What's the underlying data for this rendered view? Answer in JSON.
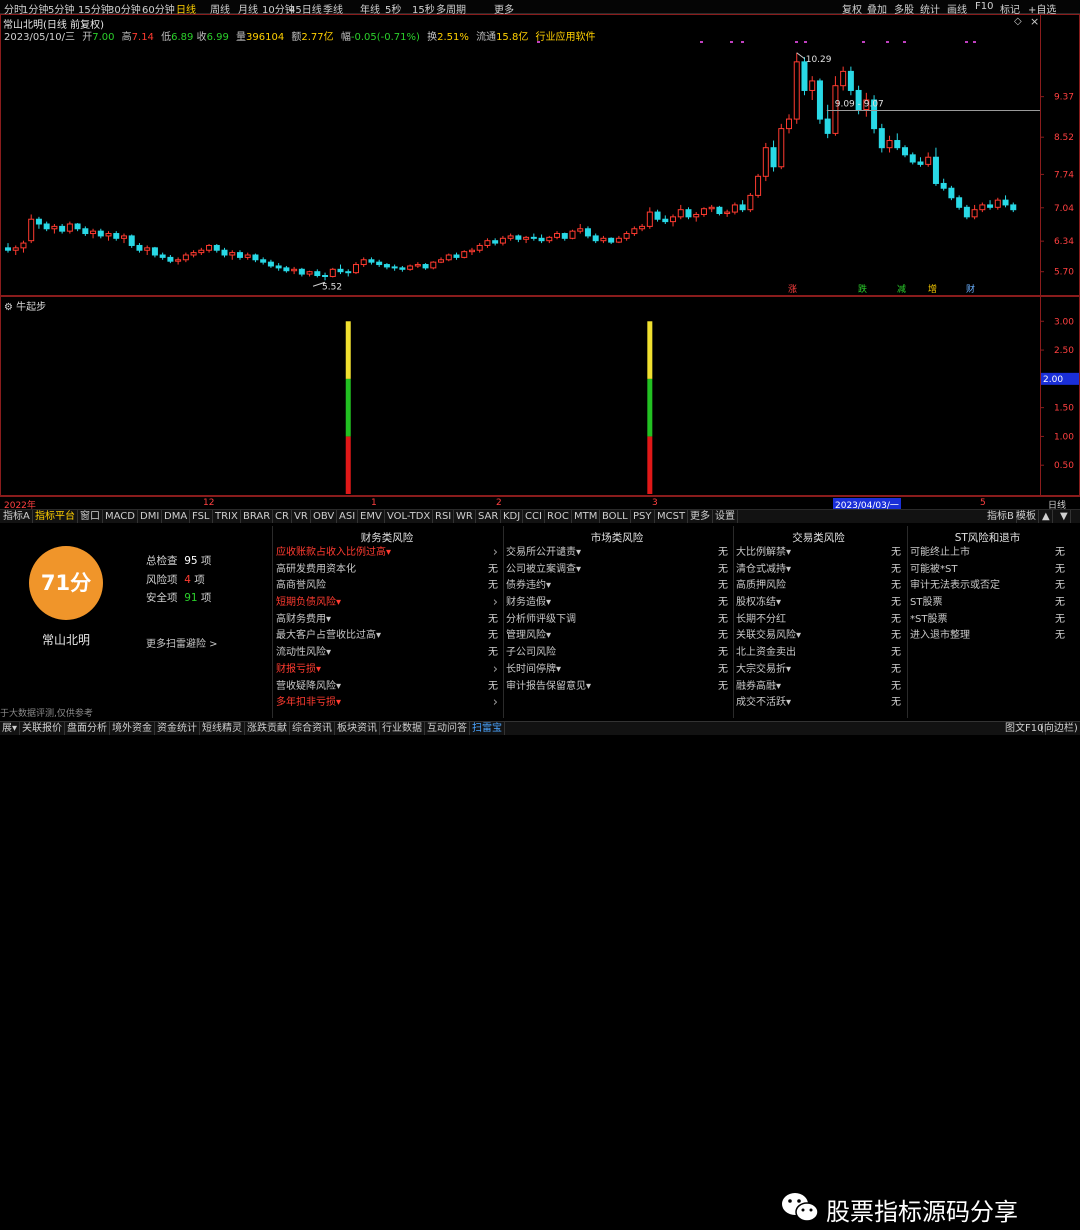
{
  "periods": [
    "分时",
    "1分钟",
    "5分钟",
    "15分钟",
    "30分钟",
    "60分钟",
    "日线",
    "周线",
    "月线",
    "10分钟",
    "45日线",
    "季线",
    "年线",
    "5秒",
    "15秒",
    "多周期",
    "更多"
  ],
  "active_period": "日线",
  "toolbar_right": [
    "复权",
    "叠加",
    "多股",
    "统计",
    "画线",
    "F10",
    "标记",
    "+自选"
  ],
  "stock": {
    "title": "常山北明(日线 前复权)",
    "date": "2023/05/10/三",
    "open_label": "开",
    "open": "7.00",
    "high_label": "高",
    "high": "7.14",
    "low_label": "低",
    "low": "6.89",
    "close_label": "收",
    "close": "6.99",
    "volume_label": "量",
    "volume": "396104",
    "amount_label": "额",
    "amount": "2.77亿",
    "change_label": "幅",
    "change": "-0.05(-0.71%)",
    "turnover_label": "换",
    "turnover": "2.51%",
    "float_label": "流通",
    "float": "15.8亿",
    "industry": "行业应用软件"
  },
  "price_axis": [
    "9.37",
    "8.52",
    "7.74",
    "7.04",
    "6.34",
    "5.70"
  ],
  "annotations": {
    "high": "10.29",
    "low": "5.52",
    "range": "9.09 - 9.07"
  },
  "event_markers": [
    "涨",
    "跌",
    "减",
    "增",
    "财"
  ],
  "sub_indicator": {
    "name": "牛起步",
    "axis": [
      "3.00",
      "2.50",
      "2.00",
      "1.50",
      "1.00",
      "0.50"
    ],
    "current": "2.00"
  },
  "date_axis": {
    "labels": [
      "2022年",
      "12",
      "1",
      "2",
      "3",
      "2023/04/03/一",
      "5"
    ],
    "right_label": "日线"
  },
  "indicator_tabs": [
    "指标A",
    "指标平台",
    "窗口",
    "MACD",
    "DMI",
    "DMA",
    "FSL",
    "TRIX",
    "BRAR",
    "CR",
    "VR",
    "OBV",
    "ASI",
    "EMV",
    "VOL-TDX",
    "RSI",
    "WR",
    "SAR",
    "KDJ",
    "CCI",
    "ROC",
    "MTM",
    "BOLL",
    "PSY",
    "MCST",
    "更多",
    "设置"
  ],
  "active_indicator_tab": "指标平台",
  "indicator_tabs_right": [
    "指标B",
    "模板",
    "▲",
    "▼"
  ],
  "risk": {
    "score": "71分",
    "company": "常山北明",
    "total_label": "总检查",
    "total": "95",
    "total_unit": "项",
    "risk_label": "风险项",
    "risk_count": "4",
    "risk_unit": "项",
    "safe_label": "安全项",
    "safe": "91",
    "safe_unit": "项",
    "more": "更多扫雷避险 >",
    "disclaimer": "于大数据评测,仅供参考",
    "columns": [
      {
        "title": "财务类风险",
        "items": [
          {
            "label": "应收账款占收入比例过高▾",
            "value": "›",
            "risk": true
          },
          {
            "label": "高研发费用资本化",
            "value": "无",
            "risk": false
          },
          {
            "label": "高商誉风险",
            "value": "无",
            "risk": false
          },
          {
            "label": "短期负债风险▾",
            "value": "›",
            "risk": true
          },
          {
            "label": "高财务费用▾",
            "value": "无",
            "risk": false
          },
          {
            "label": "最大客户占营收比过高▾",
            "value": "无",
            "risk": false
          },
          {
            "label": "流动性风险▾",
            "value": "无",
            "risk": false
          },
          {
            "label": "财报亏损▾",
            "value": "›",
            "risk": true
          },
          {
            "label": "营收疑降风险▾",
            "value": "无",
            "risk": false
          },
          {
            "label": "多年扣非亏损▾",
            "value": "›",
            "risk": true
          }
        ]
      },
      {
        "title": "市场类风险",
        "items": [
          {
            "label": "交易所公开谴责▾",
            "value": "无",
            "risk": false
          },
          {
            "label": "公司被立案调查▾",
            "value": "无",
            "risk": false
          },
          {
            "label": "债券违约▾",
            "value": "无",
            "risk": false
          },
          {
            "label": "财务造假▾",
            "value": "无",
            "risk": false
          },
          {
            "label": "分析师评级下调",
            "value": "无",
            "risk": false
          },
          {
            "label": "管理风险▾",
            "value": "无",
            "risk": false
          },
          {
            "label": "子公司风险",
            "value": "无",
            "risk": false
          },
          {
            "label": "长时间停牌▾",
            "value": "无",
            "risk": false
          },
          {
            "label": "审计报告保留意见▾",
            "value": "无",
            "risk": false
          }
        ]
      },
      {
        "title": "交易类风险",
        "items": [
          {
            "label": "大比例解禁▾",
            "value": "无",
            "risk": false
          },
          {
            "label": "清仓式减持▾",
            "value": "无",
            "risk": false
          },
          {
            "label": "高质押风险",
            "value": "无",
            "risk": false
          },
          {
            "label": "股权冻结▾",
            "value": "无",
            "risk": false
          },
          {
            "label": "长期不分红",
            "value": "无",
            "risk": false
          },
          {
            "label": "关联交易风险▾",
            "value": "无",
            "risk": false
          },
          {
            "label": "北上资金卖出",
            "value": "无",
            "risk": false
          },
          {
            "label": "大宗交易折▾",
            "value": "无",
            "risk": false
          },
          {
            "label": "融券高融▾",
            "value": "无",
            "risk": false
          },
          {
            "label": "成交不活跃▾",
            "value": "无",
            "risk": false
          }
        ]
      },
      {
        "title": "ST风险和退市",
        "items": [
          {
            "label": "可能终止上市",
            "value": "无",
            "risk": false
          },
          {
            "label": "可能被*ST",
            "value": "无",
            "risk": false
          },
          {
            "label": "审计无法表示或否定",
            "value": "无",
            "risk": false
          },
          {
            "label": "ST股票",
            "value": "无",
            "risk": false
          },
          {
            "label": "*ST股票",
            "value": "无",
            "risk": false
          },
          {
            "label": "进入退市整理",
            "value": "无",
            "risk": false
          }
        ]
      }
    ]
  },
  "statusbar": [
    "展▾",
    "关联报价",
    "盘面分析",
    "境外资金",
    "资金统计",
    "短线精灵",
    "涨跌贡献",
    "综合资讯",
    "板块资讯",
    "行业数据",
    "互动问答",
    "扫雷宝"
  ],
  "active_status": "扫雷宝",
  "statusbar_right": "图文F10",
  "statusbar_right2": "(向边栏)",
  "watermark": "股票指标源码分享",
  "colors": {
    "up": "#ff3b30",
    "down": "#29d9e6",
    "accent": "#ffd000",
    "score_bg": "#f0952a"
  },
  "chart_data": {
    "type": "candlestick",
    "ylim": [
      5.4,
      10.6
    ],
    "candles": [
      [
        6.2,
        6.3,
        6.1,
        6.15
      ],
      [
        6.15,
        6.25,
        6.05,
        6.2
      ],
      [
        6.2,
        6.35,
        6.1,
        6.3
      ],
      [
        6.35,
        6.9,
        6.3,
        6.8
      ],
      [
        6.8,
        6.85,
        6.6,
        6.7
      ],
      [
        6.7,
        6.75,
        6.55,
        6.6
      ],
      [
        6.6,
        6.7,
        6.5,
        6.65
      ],
      [
        6.65,
        6.7,
        6.5,
        6.55
      ],
      [
        6.55,
        6.75,
        6.5,
        6.7
      ],
      [
        6.7,
        6.72,
        6.55,
        6.6
      ],
      [
        6.6,
        6.65,
        6.45,
        6.5
      ],
      [
        6.5,
        6.6,
        6.4,
        6.55
      ],
      [
        6.55,
        6.6,
        6.4,
        6.45
      ],
      [
        6.45,
        6.55,
        6.35,
        6.5
      ],
      [
        6.5,
        6.55,
        6.35,
        6.4
      ],
      [
        6.4,
        6.5,
        6.3,
        6.45
      ],
      [
        6.45,
        6.48,
        6.2,
        6.25
      ],
      [
        6.25,
        6.3,
        6.1,
        6.15
      ],
      [
        6.15,
        6.25,
        6.05,
        6.2
      ],
      [
        6.2,
        6.22,
        6.0,
        6.05
      ],
      [
        6.05,
        6.1,
        5.95,
        6.0
      ],
      [
        6.0,
        6.05,
        5.88,
        5.92
      ],
      [
        5.92,
        6.0,
        5.85,
        5.95
      ],
      [
        5.95,
        6.1,
        5.9,
        6.05
      ],
      [
        6.05,
        6.15,
        6.0,
        6.1
      ],
      [
        6.1,
        6.2,
        6.05,
        6.15
      ],
      [
        6.15,
        6.28,
        6.1,
        6.25
      ],
      [
        6.25,
        6.28,
        6.1,
        6.15
      ],
      [
        6.15,
        6.2,
        6.0,
        6.05
      ],
      [
        6.05,
        6.15,
        5.95,
        6.1
      ],
      [
        6.1,
        6.15,
        5.95,
        6.0
      ],
      [
        6.0,
        6.1,
        5.95,
        6.05
      ],
      [
        6.05,
        6.08,
        5.9,
        5.95
      ],
      [
        5.95,
        6.0,
        5.85,
        5.9
      ],
      [
        5.9,
        5.95,
        5.78,
        5.82
      ],
      [
        5.82,
        5.88,
        5.72,
        5.78
      ],
      [
        5.78,
        5.82,
        5.68,
        5.72
      ],
      [
        5.72,
        5.8,
        5.65,
        5.75
      ],
      [
        5.75,
        5.78,
        5.6,
        5.65
      ],
      [
        5.65,
        5.72,
        5.6,
        5.7
      ],
      [
        5.7,
        5.75,
        5.58,
        5.62
      ],
      [
        5.62,
        5.68,
        5.52,
        5.6
      ],
      [
        5.6,
        5.78,
        5.58,
        5.75
      ],
      [
        5.75,
        5.85,
        5.65,
        5.7
      ],
      [
        5.7,
        5.75,
        5.6,
        5.68
      ],
      [
        5.68,
        5.9,
        5.65,
        5.85
      ],
      [
        5.85,
        6.0,
        5.8,
        5.95
      ],
      [
        5.95,
        6.0,
        5.85,
        5.9
      ],
      [
        5.9,
        5.95,
        5.8,
        5.85
      ],
      [
        5.85,
        5.88,
        5.75,
        5.8
      ],
      [
        5.8,
        5.85,
        5.72,
        5.78
      ],
      [
        5.78,
        5.82,
        5.7,
        5.75
      ],
      [
        5.75,
        5.85,
        5.72,
        5.82
      ],
      [
        5.82,
        5.9,
        5.78,
        5.85
      ],
      [
        5.85,
        5.88,
        5.74,
        5.78
      ],
      [
        5.78,
        5.92,
        5.75,
        5.9
      ],
      [
        5.9,
        6.0,
        5.88,
        5.95
      ],
      [
        5.95,
        6.08,
        5.92,
        6.05
      ],
      [
        6.05,
        6.1,
        5.95,
        6.0
      ],
      [
        6.0,
        6.15,
        5.98,
        6.12
      ],
      [
        6.12,
        6.2,
        6.05,
        6.15
      ],
      [
        6.15,
        6.3,
        6.1,
        6.25
      ],
      [
        6.25,
        6.4,
        6.2,
        6.35
      ],
      [
        6.35,
        6.4,
        6.25,
        6.3
      ],
      [
        6.3,
        6.45,
        6.25,
        6.4
      ],
      [
        6.4,
        6.5,
        6.35,
        6.45
      ],
      [
        6.45,
        6.48,
        6.32,
        6.38
      ],
      [
        6.38,
        6.45,
        6.3,
        6.42
      ],
      [
        6.42,
        6.5,
        6.35,
        6.4
      ],
      [
        6.4,
        6.48,
        6.3,
        6.35
      ],
      [
        6.35,
        6.45,
        6.3,
        6.42
      ],
      [
        6.42,
        6.55,
        6.38,
        6.5
      ],
      [
        6.5,
        6.52,
        6.35,
        6.4
      ],
      [
        6.4,
        6.58,
        6.38,
        6.55
      ],
      [
        6.55,
        6.7,
        6.5,
        6.6
      ],
      [
        6.6,
        6.65,
        6.4,
        6.45
      ],
      [
        6.45,
        6.5,
        6.3,
        6.35
      ],
      [
        6.35,
        6.45,
        6.3,
        6.4
      ],
      [
        6.4,
        6.42,
        6.28,
        6.32
      ],
      [
        6.32,
        6.45,
        6.3,
        6.4
      ],
      [
        6.4,
        6.55,
        6.35,
        6.5
      ],
      [
        6.5,
        6.65,
        6.45,
        6.6
      ],
      [
        6.6,
        6.7,
        6.55,
        6.65
      ],
      [
        6.65,
        7.05,
        6.6,
        6.95
      ],
      [
        6.95,
        7.0,
        6.75,
        6.8
      ],
      [
        6.8,
        6.88,
        6.7,
        6.75
      ],
      [
        6.75,
        6.9,
        6.65,
        6.85
      ],
      [
        6.85,
        7.1,
        6.8,
        7.0
      ],
      [
        7.0,
        7.05,
        6.8,
        6.85
      ],
      [
        6.85,
        6.95,
        6.75,
        6.9
      ],
      [
        6.9,
        7.05,
        6.85,
        7.02
      ],
      [
        7.02,
        7.1,
        6.95,
        7.05
      ],
      [
        7.05,
        7.08,
        6.88,
        6.92
      ],
      [
        6.92,
        7.0,
        6.85,
        6.95
      ],
      [
        6.95,
        7.15,
        6.9,
        7.1
      ],
      [
        7.1,
        7.2,
        6.95,
        7.0
      ],
      [
        7.0,
        7.35,
        6.95,
        7.3
      ],
      [
        7.3,
        7.75,
        7.25,
        7.7
      ],
      [
        7.7,
        8.4,
        7.6,
        8.3
      ],
      [
        8.3,
        8.45,
        7.8,
        7.9
      ],
      [
        7.9,
        8.8,
        7.85,
        8.7
      ],
      [
        8.7,
        9.0,
        8.6,
        8.9
      ],
      [
        8.9,
        10.29,
        8.8,
        10.1
      ],
      [
        10.1,
        10.2,
        9.4,
        9.5
      ],
      [
        9.5,
        9.8,
        9.3,
        9.7
      ],
      [
        9.7,
        9.75,
        8.8,
        8.9
      ],
      [
        8.9,
        9.2,
        8.5,
        8.6
      ],
      [
        8.6,
        9.8,
        8.55,
        9.6
      ],
      [
        9.6,
        10.0,
        9.5,
        9.9
      ],
      [
        9.9,
        10.0,
        9.4,
        9.5
      ],
      [
        9.5,
        9.6,
        9.0,
        9.1
      ],
      [
        9.1,
        9.45,
        8.95,
        9.3
      ],
      [
        9.3,
        9.4,
        8.6,
        8.7
      ],
      [
        8.7,
        8.8,
        8.2,
        8.3
      ],
      [
        8.3,
        8.55,
        8.2,
        8.45
      ],
      [
        8.45,
        8.6,
        8.25,
        8.3
      ],
      [
        8.3,
        8.35,
        8.1,
        8.15
      ],
      [
        8.15,
        8.2,
        7.95,
        8.0
      ],
      [
        8.0,
        8.1,
        7.9,
        7.95
      ],
      [
        7.95,
        8.2,
        7.9,
        8.1
      ],
      [
        8.1,
        8.3,
        7.5,
        7.55
      ],
      [
        7.55,
        7.65,
        7.4,
        7.45
      ],
      [
        7.45,
        7.5,
        7.2,
        7.25
      ],
      [
        7.25,
        7.3,
        7.0,
        7.05
      ],
      [
        7.05,
        7.1,
        6.8,
        6.85
      ],
      [
        6.85,
        7.1,
        6.8,
        7.0
      ],
      [
        7.0,
        7.15,
        6.95,
        7.1
      ],
      [
        7.1,
        7.2,
        7.0,
        7.05
      ],
      [
        7.05,
        7.25,
        7.0,
        7.2
      ],
      [
        7.2,
        7.3,
        7.05,
        7.1
      ],
      [
        7.1,
        7.15,
        6.95,
        7.0
      ]
    ],
    "signals": [
      {
        "index": 44,
        "segments": [
          {
            "from": 0,
            "to": 1,
            "color": "red"
          },
          {
            "from": 1,
            "to": 2,
            "color": "green"
          },
          {
            "from": 2,
            "to": 3,
            "color": "yellow"
          }
        ]
      },
      {
        "index": 83,
        "segments": [
          {
            "from": 0,
            "to": 1,
            "color": "red"
          },
          {
            "from": 1,
            "to": 2,
            "color": "green"
          },
          {
            "from": 2,
            "to": 3,
            "color": "yellow"
          }
        ]
      }
    ],
    "sub_ylim": [
      0,
      3.3
    ]
  }
}
